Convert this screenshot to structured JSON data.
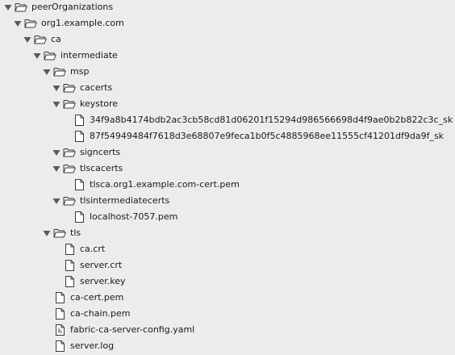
{
  "tree": [
    {
      "label": "peerOrganizations",
      "type": "folder",
      "expanded": true,
      "depth": 0
    },
    {
      "label": "org1.example.com",
      "type": "folder",
      "expanded": true,
      "depth": 1
    },
    {
      "label": "ca",
      "type": "folder",
      "expanded": true,
      "depth": 2
    },
    {
      "label": "intermediate",
      "type": "folder",
      "expanded": true,
      "depth": 3
    },
    {
      "label": "msp",
      "type": "folder",
      "expanded": true,
      "depth": 4
    },
    {
      "label": "cacerts",
      "type": "folder",
      "expanded": true,
      "depth": 5
    },
    {
      "label": "keystore",
      "type": "folder",
      "expanded": true,
      "depth": 5
    },
    {
      "label": "34f9a8b4174bdb2ac3cb58cd81d06201f15294d986566698d4f9ae0b2b822c3c_sk",
      "type": "file",
      "depth": 6
    },
    {
      "label": "87f54949484f7618d3e68807e9feca1b0f5c4885968ee11555cf41201df9da9f_sk",
      "type": "file",
      "depth": 6
    },
    {
      "label": "signcerts",
      "type": "folder",
      "expanded": true,
      "depth": 5
    },
    {
      "label": "tlscacerts",
      "type": "folder",
      "expanded": true,
      "depth": 5
    },
    {
      "label": "tlsca.org1.example.com-cert.pem",
      "type": "file",
      "depth": 6
    },
    {
      "label": "tlsintermediatecerts",
      "type": "folder",
      "expanded": true,
      "depth": 5
    },
    {
      "label": "localhost-7057.pem",
      "type": "file",
      "depth": 6
    },
    {
      "label": "tls",
      "type": "folder",
      "expanded": true,
      "depth": 4
    },
    {
      "label": "ca.crt",
      "type": "file",
      "depth": 5
    },
    {
      "label": "server.crt",
      "type": "file",
      "depth": 5
    },
    {
      "label": "server.key",
      "type": "file",
      "depth": 5
    },
    {
      "label": "ca-cert.pem",
      "type": "file",
      "depth": 4
    },
    {
      "label": "ca-chain.pem",
      "type": "file",
      "depth": 4
    },
    {
      "label": "fabric-ca-server-config.yaml",
      "type": "yaml",
      "depth": 4
    },
    {
      "label": "server.log",
      "type": "file",
      "depth": 4
    }
  ],
  "icons": {
    "expanded_triangle": "disclosure-triangle-down-icon",
    "folder": "open-folder-icon",
    "file": "document-icon",
    "yaml": "config-document-icon"
  },
  "colors": {
    "background": "#ececec",
    "text": "#1a1a1a",
    "icon_stroke": "#3a3a3a",
    "triangle": "#5a5a5a"
  }
}
